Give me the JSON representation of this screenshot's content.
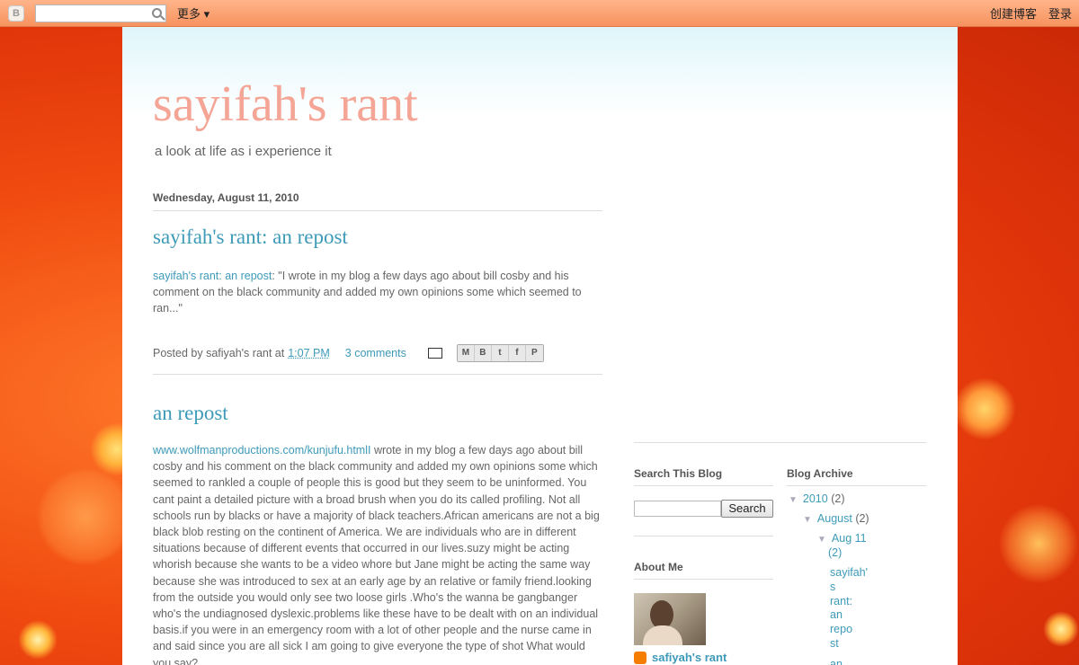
{
  "navbar": {
    "more_label": "更多 ▾",
    "create_blog": "创建博客",
    "login": "登录"
  },
  "blog": {
    "title": "sayifah's rant",
    "description": "a look at life as i experience it"
  },
  "post1": {
    "date": "Wednesday, August 11, 2010",
    "title": "sayifah's rant: an repost",
    "body_link": "sayifah's rant: an repost",
    "body_text": ": \"I wrote in my blog a few days ago about bill cosby and his comment on the black community and added my own opinions some which seemed to ran...\"",
    "posted_by": "Posted by safiyah's rant at",
    "time": "1:07 PM",
    "comments": "3 comments"
  },
  "post2": {
    "title": "an repost",
    "body_link": "www.wolfmanproductions.com/kunjufu.htmlI",
    "body_text": " wrote in my blog a few days ago about bill cosby and his comment on the black community and added my own opinions some which seemed to rankled a couple of people this is good but they seem to be uninformed. You cant paint a detailed picture with a broad brush when you do its called profiling. Not all schools run by blacks or have a majority of black teachers.African americans are not a big black blob resting on the continent of America. We are individuals who are in different situations because of different events that occurred in our lives.suzy might be acting whorish because she wants to be a video whore but Jane might be acting the same way because she was introduced to sex at an early age by an relative or family friend.looking from the outside you would only see two loose girls .Who's the wanna be gangbanger who's the undiagnosed dyslexic.problems like these have to be dealt with on an individual basis.if you were in an emergency room with a lot of other people and the nurse came in and said since you are all sick I am going to give everyone the type of shot What would you say?"
  },
  "sidebar": {
    "search_title": "Search This Blog",
    "search_button": "Search",
    "about_title": "About Me",
    "profile_name": "safiyah's rant",
    "archive_title": "Blog Archive",
    "archive": {
      "year": "2010",
      "year_count": "(2)",
      "month": "August",
      "month_count": "(2)",
      "day": "Aug 11",
      "day_count": "(2)",
      "post_lines": [
        "sayifah'",
        "s",
        "rant:",
        "an",
        "repo",
        "st"
      ],
      "next_post": "an"
    }
  }
}
